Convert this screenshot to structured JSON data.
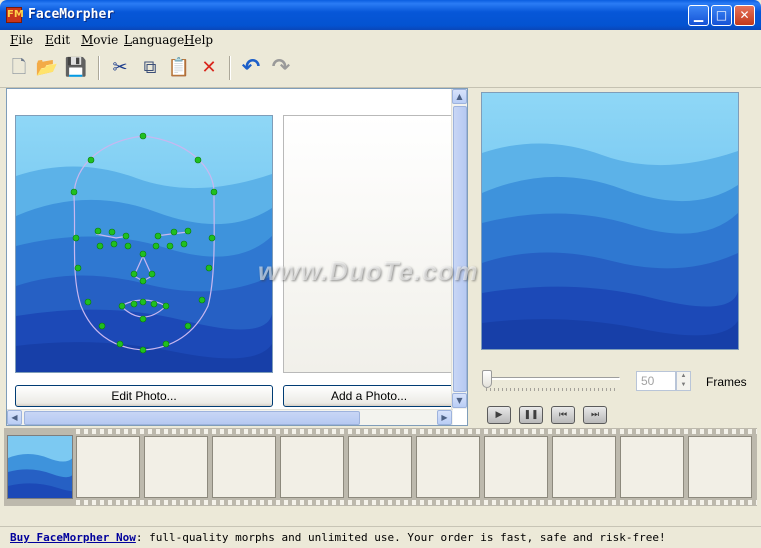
{
  "window": {
    "title": "FaceMorpher",
    "app_icon_text": "FM",
    "min_glyph": "▁",
    "max_glyph": "□",
    "close_glyph": "✕"
  },
  "menu": [
    {
      "accel": "F",
      "rest": "ile"
    },
    {
      "accel": "E",
      "rest": "dit"
    },
    {
      "accel": "M",
      "rest": "ovie"
    },
    {
      "accel": "L",
      "rest": "anguage"
    },
    {
      "accel": "H",
      "rest": "elp"
    }
  ],
  "toolbar": {
    "icons": [
      "new-document-icon",
      "open-folder-icon",
      "save-icon",
      "cut-icon",
      "copy-icon",
      "paste-icon",
      "delete-icon",
      "undo-icon",
      "redo-icon"
    ],
    "glyphs": {
      "new": "🗋",
      "open": "📂",
      "save": "💾",
      "cut": "✂",
      "copy": "⧉",
      "paste": "📋",
      "delete": "✕",
      "undo": "↶",
      "redo": "↷"
    },
    "colors": {
      "delete": "#d9261c",
      "undo": "#1c5fc9",
      "redo": "#9a9a9a",
      "save": "#1f3f9a",
      "open": "#d9a521"
    }
  },
  "photo_panel": {
    "edit_button": "Edit Photo...",
    "add_button": "Add a Photo..."
  },
  "preview": {
    "frames_value": "50",
    "frames_label": "Frames",
    "slider_level": 0,
    "controls": {
      "play": "▶",
      "pause": "❚❚",
      "rewind": "⏮",
      "forward": "⏭"
    }
  },
  "watermark": "www.DuoTe.com",
  "status": {
    "link": "Buy FaceMorpher Now",
    "text": ": full-quality morphs and unlimited use. Your order is fast, safe and risk-free!"
  },
  "colors": {
    "titlebar": "#0757d8",
    "sky_top": "#8fd3f5",
    "mountain_dark": "#1c49b7",
    "face_curve": "#c8b7f0",
    "marker": "#20c020"
  }
}
